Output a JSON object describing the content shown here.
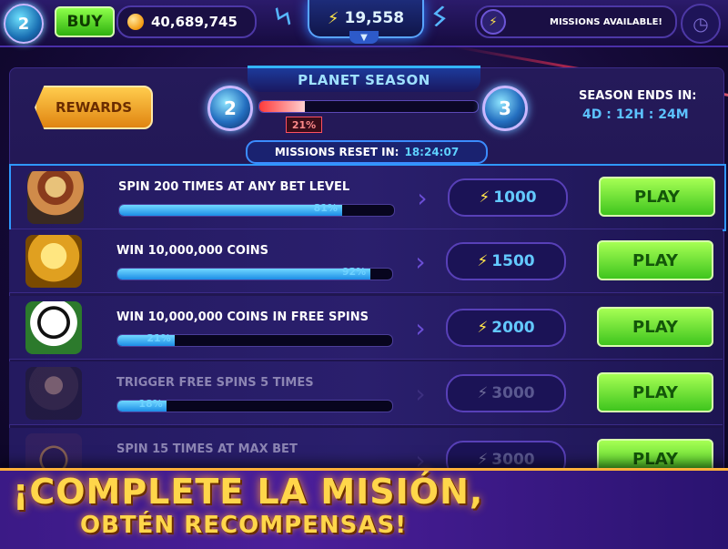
{
  "header": {
    "level": "2",
    "buy_label": "BUY",
    "coins": "40,689,745",
    "energy": "19,558",
    "missions_status": "MISSIONS AVAILABLE!",
    "icons": {
      "coin": "coin-icon",
      "bolt": "lightning-bolt-icon",
      "clock": "clock-icon",
      "chevron": "chevron-down-icon"
    },
    "bolt_glyph": "⚡",
    "chevron_glyph": "▼",
    "clock_glyph": "◷"
  },
  "season": {
    "title": "PLANET SEASON",
    "rewards_label": "REWARDS",
    "current_level": "2",
    "next_level": "3",
    "progress_percent": 21,
    "progress_label": "21%",
    "ends_label": "SEASON ENDS IN:",
    "ends_value": "4D : 12H : 24M",
    "reset_label": "MISSIONS RESET IN:",
    "reset_value": "18:24:07"
  },
  "missions": [
    {
      "title": "SPIN 200 TIMES AT ANY BET LEVEL",
      "progress": 81,
      "progress_label": "81%",
      "reward": "1000",
      "button": "PLAY",
      "avatar": "cowboy-sombrero",
      "state": "selected"
    },
    {
      "title": "WIN 10,000,000 COINS",
      "progress": 92,
      "progress_label": "92%",
      "reward": "1500",
      "button": "PLAY",
      "avatar": "golden-buddha",
      "state": "normal"
    },
    {
      "title": "WIN 10,000,000 COINS IN FREE SPINS",
      "progress": 21,
      "progress_label": "21%",
      "reward": "2000",
      "button": "PLAY",
      "avatar": "panda",
      "state": "normal"
    },
    {
      "title": "TRIGGER FREE SPINS 5 TIMES",
      "progress": 18,
      "progress_label": "18%",
      "reward": "3000",
      "button": "PLAY",
      "avatar": "warrior-woman",
      "state": "dim"
    },
    {
      "title": "SPIN 15 TIMES AT MAX BET",
      "progress": 0,
      "progress_label": "",
      "reward": "3000",
      "button": "PLAY",
      "avatar": "dreamcatcher",
      "state": "dim"
    }
  ],
  "promo": {
    "line1": "¡COMPLETE LA MISIÓN,",
    "line2": "OBTÉN RECOMPENSAS!"
  },
  "colors": {
    "accent_blue": "#5cc2ff",
    "play_green": "#3fc51e",
    "gold": "#ffd64a",
    "season_red": "#ff3a3a"
  }
}
